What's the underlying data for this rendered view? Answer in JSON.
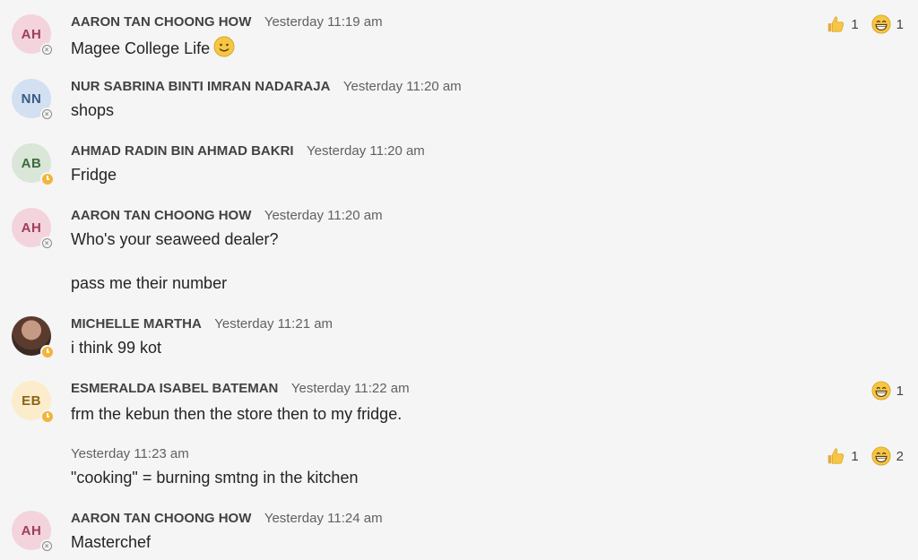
{
  "messages": [
    {
      "avatar_initials": "AH",
      "avatar_bg": "#f4d4dc",
      "avatar_fg": "#9e3f5a",
      "status": "offline",
      "name": "AARON TAN CHOONG HOW",
      "time": "Yesterday 11:19 am",
      "text": "Magee College Life",
      "inline_emoji": "smiley-icon",
      "reactions": [
        {
          "icon": "thumbs-up-icon",
          "count": "1"
        },
        {
          "icon": "grin-icon",
          "count": "1"
        }
      ]
    },
    {
      "avatar_initials": "NN",
      "avatar_bg": "#d3e0f1",
      "avatar_fg": "#3a5a86",
      "status": "offline",
      "name": "NUR SABRINA BINTI IMRAN NADARAJA",
      "time": "Yesterday 11:20 am",
      "text": "shops"
    },
    {
      "avatar_initials": "AB",
      "avatar_bg": "#d9e6d8",
      "avatar_fg": "#3f6a3d",
      "status": "away",
      "name": "AHMAD RADIN BIN AHMAD BAKRI",
      "time": "Yesterday 11:20 am",
      "text": "Fridge"
    },
    {
      "avatar_initials": "AH",
      "avatar_bg": "#f4d4dc",
      "avatar_fg": "#9e3f5a",
      "status": "offline",
      "name": "AARON TAN CHOONG HOW",
      "time": "Yesterday 11:20 am",
      "text": "Who's your seaweed dealer?",
      "text2": "pass me their number"
    },
    {
      "avatar_initials": "",
      "status": "away",
      "name": "MICHELLE MARTHA",
      "time": "Yesterday 11:21 am",
      "text": "i think 99 kot"
    },
    {
      "avatar_initials": "EB",
      "avatar_bg": "#fbeccc",
      "avatar_fg": "#8a6418",
      "status": "away",
      "name": "ESMERALDA ISABEL BATEMAN",
      "time": "Yesterday 11:22 am",
      "text": "frm the kebun then the store then to my fridge.",
      "reactions": [
        {
          "icon": "grin-icon",
          "count": "1"
        }
      ]
    },
    {
      "time": "Yesterday 11:23 am",
      "text": "\"cooking\" = burning smtng in the kitchen",
      "reactions": [
        {
          "icon": "thumbs-up-icon",
          "count": "1"
        },
        {
          "icon": "grin-icon",
          "count": "2"
        }
      ]
    },
    {
      "avatar_initials": "AH",
      "avatar_bg": "#f4d4dc",
      "avatar_fg": "#9e3f5a",
      "status": "offline",
      "name": "AARON TAN CHOONG HOW",
      "time": "Yesterday 11:24 am",
      "text": "Masterchef"
    }
  ]
}
